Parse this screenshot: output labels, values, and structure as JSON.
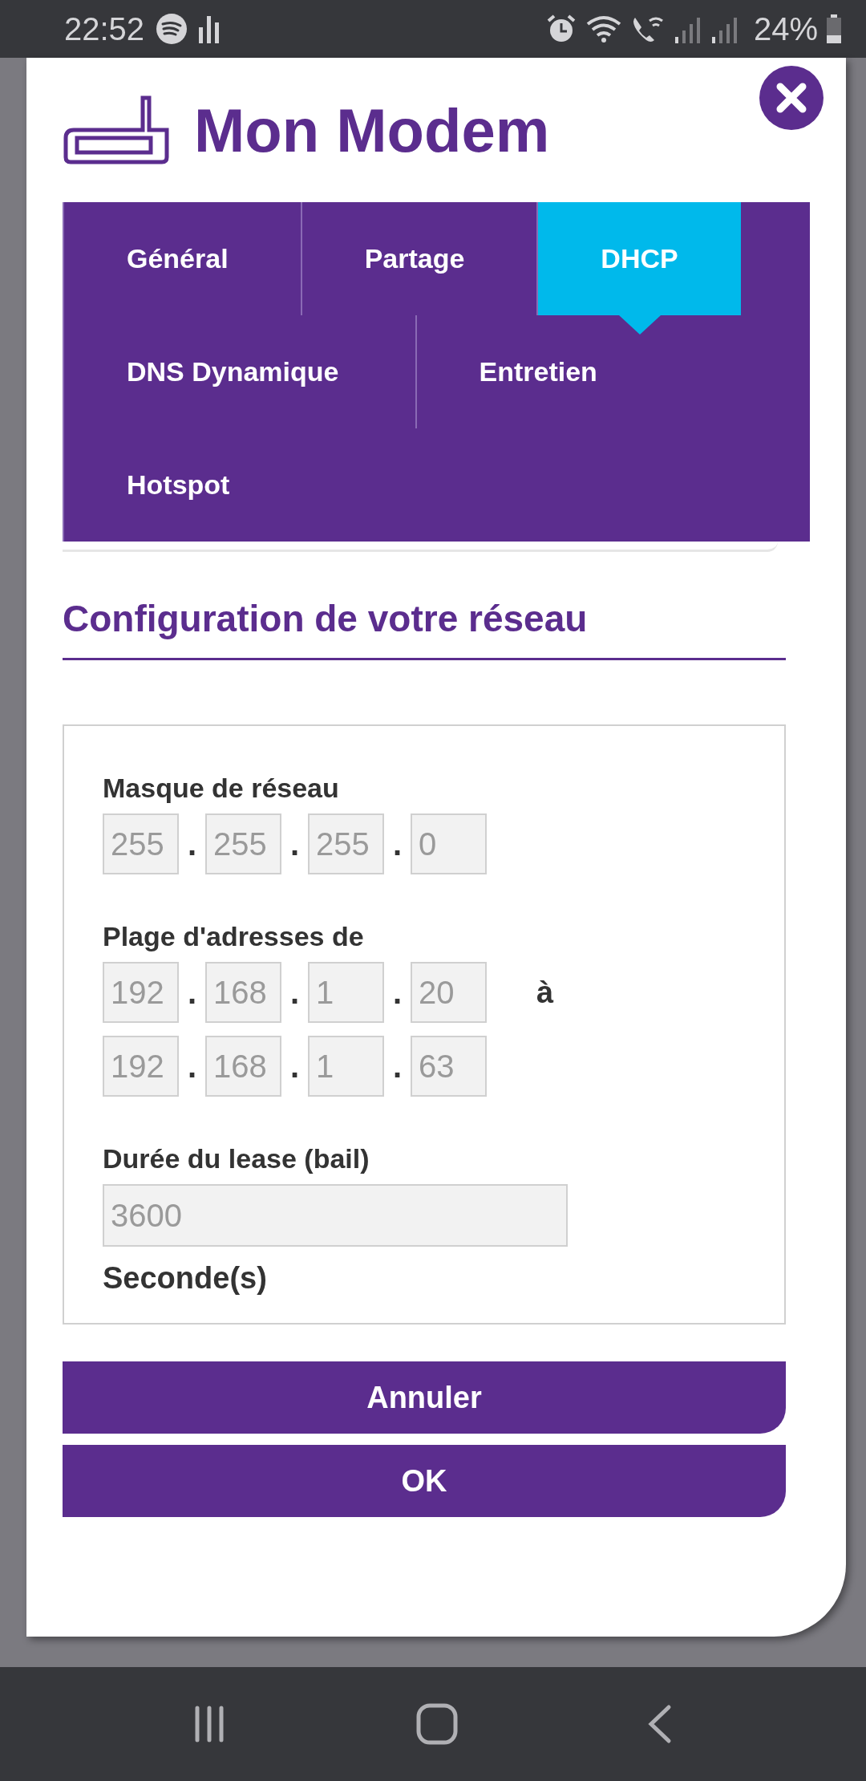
{
  "status_bar": {
    "time": "22:52",
    "battery": "24%"
  },
  "dialog": {
    "title": "Mon Modem"
  },
  "tabs": [
    {
      "label": "Général",
      "selected": false
    },
    {
      "label": "Partage",
      "selected": false
    },
    {
      "label": "DHCP",
      "selected": true
    },
    {
      "label": "DNS Dynamique",
      "selected": false
    },
    {
      "label": "Entretien",
      "selected": false
    },
    {
      "label": "Hotspot",
      "selected": false
    }
  ],
  "section_title": "Configuration de votre réseau",
  "form": {
    "separator": ".",
    "netmask": {
      "label": "Masque de réseau",
      "octets": [
        "255",
        "255",
        "255",
        "0"
      ]
    },
    "range": {
      "label": "Plage d'adresses de",
      "start": [
        "192",
        "168",
        "1",
        "20"
      ],
      "to": "à",
      "end": [
        "192",
        "168",
        "1",
        "63"
      ]
    },
    "lease": {
      "label": "Durée du lease (bail)",
      "value": "3600",
      "unit": "Seconde(s)"
    }
  },
  "buttons": [
    "Annuler",
    "OK"
  ]
}
